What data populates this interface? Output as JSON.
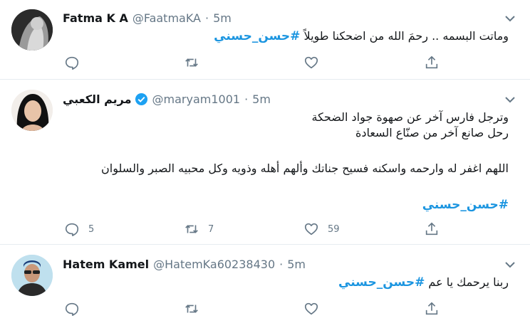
{
  "tweets": [
    {
      "name": "Fatma K A",
      "handle": "@FaatmaKA",
      "separator": "·",
      "time": "5m",
      "text_lines": [
        "وماتت البسمه .. رحمَ الله من اضحكنا طويلاً"
      ],
      "hashtag": "#حسن_حسني",
      "counts": {
        "reply": "",
        "retweet": "",
        "like": ""
      }
    },
    {
      "name": "مريم الكعبي",
      "handle": "@maryam1001",
      "separator": "·",
      "time": "5m",
      "verified": true,
      "text_lines": [
        "وترجل فارس آخر عن صهوة جواد الضحكة",
        "رحل صانع آخر من صنّاع السعادة",
        "",
        "اللهم اغفر له وارحمه واسكنه فسيح جناتك وألهم أهله وذويه وكل محبيه الصبر والسلوان"
      ],
      "hashtag": "#حسن_حسني",
      "counts": {
        "reply": "5",
        "retweet": "7",
        "like": "59"
      }
    },
    {
      "name": "Hatem Kamel",
      "handle": "@HatemKa60238430",
      "separator": "·",
      "time": "5m",
      "text_lines": [
        "ربنا يرحمك يا عم"
      ],
      "hashtag": "#حسن_حسني",
      "counts": {
        "reply": "",
        "retweet": "",
        "like": ""
      }
    }
  ],
  "colors": {
    "link": "#1b95e0",
    "muted": "#657786",
    "verified": "#1da1f2",
    "divider": "#e6ecf0"
  },
  "icons": {
    "reply": "reply-icon",
    "retweet": "retweet-icon",
    "like": "heart-icon",
    "share": "share-icon",
    "menu": "chevron-down-icon"
  }
}
